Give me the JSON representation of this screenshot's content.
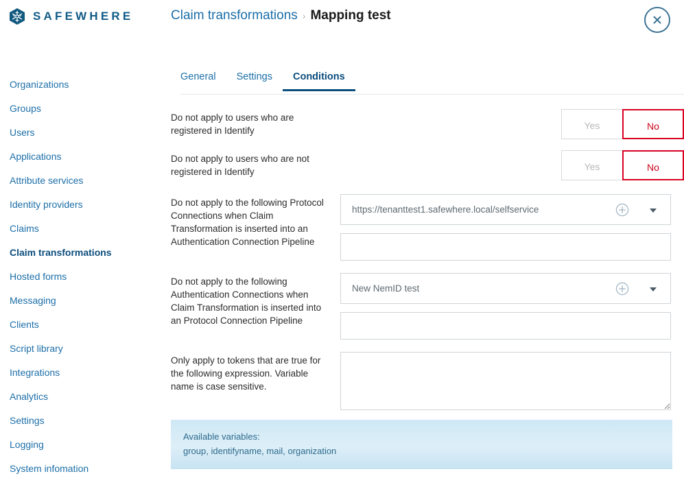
{
  "brand": {
    "name": "SAFEWHERE",
    "logo_icon": "snowflake-hexagon-icon",
    "accent": "#115b88"
  },
  "header": {
    "breadcrumb": {
      "parent": "Claim transformations",
      "separator": "›",
      "current": "Mapping test"
    },
    "close_icon": "close-icon",
    "close_label": "Close"
  },
  "sidebar": {
    "items": [
      {
        "label": "Organizations",
        "active": false
      },
      {
        "label": "Groups",
        "active": false
      },
      {
        "label": "Users",
        "active": false
      },
      {
        "label": "Applications",
        "active": false
      },
      {
        "label": "Attribute services",
        "active": false
      },
      {
        "label": "Identity providers",
        "active": false
      },
      {
        "label": "Claims",
        "active": false
      },
      {
        "label": "Claim transformations",
        "active": true
      },
      {
        "label": "Hosted forms",
        "active": false
      },
      {
        "label": "Messaging",
        "active": false
      },
      {
        "label": "Clients",
        "active": false
      },
      {
        "label": "Script library",
        "active": false
      },
      {
        "label": "Integrations",
        "active": false
      },
      {
        "label": "Analytics",
        "active": false
      },
      {
        "label": "Settings",
        "active": false
      },
      {
        "label": "Logging",
        "active": false
      },
      {
        "label": "System infomation",
        "active": false
      }
    ],
    "link_color": "#1b6ea8",
    "active_color": "#0b4d7d"
  },
  "main": {
    "tabs": [
      {
        "label": "General",
        "active": false
      },
      {
        "label": "Settings",
        "active": false
      },
      {
        "label": "Conditions",
        "active": true
      }
    ],
    "toggle_options": {
      "yes": "Yes",
      "no": "No"
    },
    "selected_color": "#d80022",
    "rows": {
      "registered": {
        "label": "Do not apply to users who are registered in Identify",
        "selected": "No"
      },
      "not_registered": {
        "label": "Do not apply to users who are not registered in Identify",
        "selected": "No"
      },
      "protocol_connections": {
        "label": "Do not apply to the following Protocol Connections when Claim Transformation is inserted into an Authentication Connection Pipeline",
        "value": "https://tenanttest1.safewhere.local/selfservice",
        "add_icon": "plus-circle-icon",
        "caret_icon": "chevron-down-icon",
        "secondary_value": ""
      },
      "authentication_connections": {
        "label": "Do not apply to the following Authentication Connections when Claim Transformation is inserted into an Protocol Connection Pipeline",
        "value": "New NemID test",
        "add_icon": "plus-circle-icon",
        "caret_icon": "chevron-down-icon",
        "secondary_value": ""
      },
      "expression": {
        "label": "Only apply to tokens that are true for the following expression. Variable name is case sensitive.",
        "value": "",
        "placeholder": ""
      }
    },
    "info_banner": {
      "title": "Available variables:",
      "variables": "group, identifyname, mail, organization"
    }
  }
}
